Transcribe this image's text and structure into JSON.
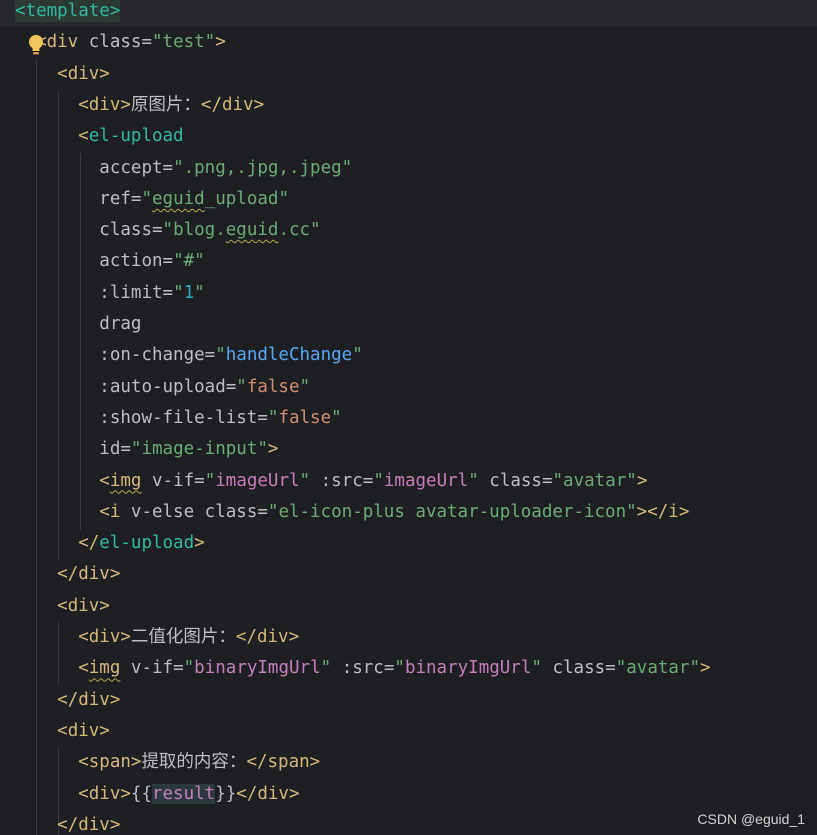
{
  "editor": {
    "language": "vue",
    "background": "#1e1f22",
    "current_line_background": "#26282e",
    "colors": {
      "tag": "#d5b778",
      "attribute": "#bcbec4",
      "string": "#6aab73",
      "number": "#2aacb8",
      "handler": "#56a8f5",
      "expression": "#c77dbb",
      "template_tag": "#2fb9a0",
      "boolean": "#cf8e6d"
    },
    "intention_icon": "lightbulb-icon",
    "lines": [
      {
        "segments": [
          {
            "text": "<template>",
            "cls": "c-template-tag"
          }
        ],
        "current": true
      },
      {
        "segments": [
          {
            "text": "  ",
            "cls": "c-plain"
          },
          {
            "text": "<div ",
            "cls": "c-tag"
          },
          {
            "text": "class",
            "cls": "c-attr"
          },
          {
            "text": "=",
            "cls": "c-plain"
          },
          {
            "text": "\"test\"",
            "cls": "c-str"
          },
          {
            "text": ">",
            "cls": "c-tag"
          }
        ]
      },
      {
        "segments": [
          {
            "text": "    ",
            "cls": "c-plain"
          },
          {
            "text": "<div>",
            "cls": "c-tag"
          }
        ]
      },
      {
        "segments": [
          {
            "text": "      ",
            "cls": "c-plain"
          },
          {
            "text": "<div>",
            "cls": "c-tag"
          },
          {
            "text": "原图片：",
            "cls": "c-cjk"
          },
          {
            "text": "</div>",
            "cls": "c-tag"
          }
        ]
      },
      {
        "segments": [
          {
            "text": "      ",
            "cls": "c-plain"
          },
          {
            "text": "<",
            "cls": "c-tag"
          },
          {
            "text": "el-upload",
            "cls": "c-teal"
          }
        ]
      },
      {
        "segments": [
          {
            "text": "        ",
            "cls": "c-plain"
          },
          {
            "text": "accept",
            "cls": "c-attr"
          },
          {
            "text": "=",
            "cls": "c-plain"
          },
          {
            "text": "\".png,.jpg,.jpeg\"",
            "cls": "c-str"
          }
        ]
      },
      {
        "segments": [
          {
            "text": "        ",
            "cls": "c-plain"
          },
          {
            "text": "ref",
            "cls": "c-attr"
          },
          {
            "text": "=",
            "cls": "c-plain"
          },
          {
            "text": "\"",
            "cls": "c-str"
          },
          {
            "text": "eguid",
            "cls": "c-str squiggle"
          },
          {
            "text": "_upload\"",
            "cls": "c-str"
          }
        ]
      },
      {
        "segments": [
          {
            "text": "        ",
            "cls": "c-plain"
          },
          {
            "text": "class",
            "cls": "c-attr"
          },
          {
            "text": "=",
            "cls": "c-plain"
          },
          {
            "text": "\"blog.",
            "cls": "c-str"
          },
          {
            "text": "eguid",
            "cls": "c-str squiggle"
          },
          {
            "text": ".cc\"",
            "cls": "c-str"
          }
        ]
      },
      {
        "segments": [
          {
            "text": "        ",
            "cls": "c-plain"
          },
          {
            "text": "action",
            "cls": "c-attr"
          },
          {
            "text": "=",
            "cls": "c-plain"
          },
          {
            "text": "\"#\"",
            "cls": "c-str"
          }
        ]
      },
      {
        "segments": [
          {
            "text": "        ",
            "cls": "c-plain"
          },
          {
            "text": ":limit",
            "cls": "c-attr"
          },
          {
            "text": "=",
            "cls": "c-plain"
          },
          {
            "text": "\"",
            "cls": "c-str"
          },
          {
            "text": "1",
            "cls": "c-num"
          },
          {
            "text": "\"",
            "cls": "c-str"
          }
        ]
      },
      {
        "segments": [
          {
            "text": "        ",
            "cls": "c-plain"
          },
          {
            "text": "drag",
            "cls": "c-attr"
          }
        ]
      },
      {
        "segments": [
          {
            "text": "        ",
            "cls": "c-plain"
          },
          {
            "text": ":on-change",
            "cls": "c-attr"
          },
          {
            "text": "=",
            "cls": "c-plain"
          },
          {
            "text": "\"",
            "cls": "c-str"
          },
          {
            "text": "handleChange",
            "cls": "c-ref"
          },
          {
            "text": "\"",
            "cls": "c-str"
          }
        ]
      },
      {
        "segments": [
          {
            "text": "        ",
            "cls": "c-plain"
          },
          {
            "text": ":auto-upload",
            "cls": "c-attr"
          },
          {
            "text": "=",
            "cls": "c-plain"
          },
          {
            "text": "\"",
            "cls": "c-str"
          },
          {
            "text": "false",
            "cls": "c-bool"
          },
          {
            "text": "\"",
            "cls": "c-str"
          }
        ]
      },
      {
        "segments": [
          {
            "text": "        ",
            "cls": "c-plain"
          },
          {
            "text": ":show-file-list",
            "cls": "c-attr"
          },
          {
            "text": "=",
            "cls": "c-plain"
          },
          {
            "text": "\"",
            "cls": "c-str"
          },
          {
            "text": "false",
            "cls": "c-bool"
          },
          {
            "text": "\"",
            "cls": "c-str"
          }
        ]
      },
      {
        "segments": [
          {
            "text": "        ",
            "cls": "c-plain"
          },
          {
            "text": "id",
            "cls": "c-attr"
          },
          {
            "text": "=",
            "cls": "c-plain"
          },
          {
            "text": "\"image-input\"",
            "cls": "c-str"
          },
          {
            "text": ">",
            "cls": "c-tag"
          }
        ]
      },
      {
        "segments": [
          {
            "text": "        ",
            "cls": "c-plain"
          },
          {
            "text": "<",
            "cls": "c-tag"
          },
          {
            "text": "img",
            "cls": "c-tag squiggle"
          },
          {
            "text": " ",
            "cls": "c-plain"
          },
          {
            "text": "v-if",
            "cls": "c-attr"
          },
          {
            "text": "=",
            "cls": "c-plain"
          },
          {
            "text": "\"",
            "cls": "c-str"
          },
          {
            "text": "imageUrl",
            "cls": "c-expr"
          },
          {
            "text": "\"",
            "cls": "c-str"
          },
          {
            "text": " ",
            "cls": "c-plain"
          },
          {
            "text": ":src",
            "cls": "c-attr"
          },
          {
            "text": "=",
            "cls": "c-plain"
          },
          {
            "text": "\"",
            "cls": "c-str"
          },
          {
            "text": "imageUrl",
            "cls": "c-expr"
          },
          {
            "text": "\"",
            "cls": "c-str"
          },
          {
            "text": " ",
            "cls": "c-plain"
          },
          {
            "text": "class",
            "cls": "c-attr"
          },
          {
            "text": "=",
            "cls": "c-plain"
          },
          {
            "text": "\"avatar\"",
            "cls": "c-str"
          },
          {
            "text": ">",
            "cls": "c-tag"
          }
        ]
      },
      {
        "segments": [
          {
            "text": "        ",
            "cls": "c-plain"
          },
          {
            "text": "<i ",
            "cls": "c-tag"
          },
          {
            "text": "v-else",
            "cls": "c-attr"
          },
          {
            "text": " ",
            "cls": "c-plain"
          },
          {
            "text": "class",
            "cls": "c-attr"
          },
          {
            "text": "=",
            "cls": "c-plain"
          },
          {
            "text": "\"el-icon-plus avatar-uploader-icon\"",
            "cls": "c-str"
          },
          {
            "text": "></i>",
            "cls": "c-tag"
          }
        ]
      },
      {
        "segments": [
          {
            "text": "      ",
            "cls": "c-plain"
          },
          {
            "text": "</",
            "cls": "c-tag"
          },
          {
            "text": "el-upload",
            "cls": "c-teal"
          },
          {
            "text": ">",
            "cls": "c-tag"
          }
        ]
      },
      {
        "segments": [
          {
            "text": "    ",
            "cls": "c-plain"
          },
          {
            "text": "</div>",
            "cls": "c-tag"
          }
        ]
      },
      {
        "segments": [
          {
            "text": "    ",
            "cls": "c-plain"
          },
          {
            "text": "<div>",
            "cls": "c-tag"
          }
        ]
      },
      {
        "segments": [
          {
            "text": "      ",
            "cls": "c-plain"
          },
          {
            "text": "<div>",
            "cls": "c-tag"
          },
          {
            "text": "二值化图片：",
            "cls": "c-cjk"
          },
          {
            "text": "</div>",
            "cls": "c-tag"
          }
        ]
      },
      {
        "segments": [
          {
            "text": "      ",
            "cls": "c-plain"
          },
          {
            "text": "<",
            "cls": "c-tag"
          },
          {
            "text": "img",
            "cls": "c-tag squiggle"
          },
          {
            "text": " ",
            "cls": "c-plain"
          },
          {
            "text": "v-if",
            "cls": "c-attr"
          },
          {
            "text": "=",
            "cls": "c-plain"
          },
          {
            "text": "\"",
            "cls": "c-str"
          },
          {
            "text": "binaryImgUrl",
            "cls": "c-expr"
          },
          {
            "text": "\"",
            "cls": "c-str"
          },
          {
            "text": " ",
            "cls": "c-plain"
          },
          {
            "text": ":src",
            "cls": "c-attr"
          },
          {
            "text": "=",
            "cls": "c-plain"
          },
          {
            "text": "\"",
            "cls": "c-str"
          },
          {
            "text": "binaryImgUrl",
            "cls": "c-expr"
          },
          {
            "text": "\"",
            "cls": "c-str"
          },
          {
            "text": " ",
            "cls": "c-plain"
          },
          {
            "text": "class",
            "cls": "c-attr"
          },
          {
            "text": "=",
            "cls": "c-plain"
          },
          {
            "text": "\"avatar\"",
            "cls": "c-str"
          },
          {
            "text": ">",
            "cls": "c-tag"
          }
        ]
      },
      {
        "segments": [
          {
            "text": "    ",
            "cls": "c-plain"
          },
          {
            "text": "</div>",
            "cls": "c-tag"
          }
        ]
      },
      {
        "segments": [
          {
            "text": "    ",
            "cls": "c-plain"
          },
          {
            "text": "<div>",
            "cls": "c-tag"
          }
        ]
      },
      {
        "segments": [
          {
            "text": "      ",
            "cls": "c-plain"
          },
          {
            "text": "<span>",
            "cls": "c-tag"
          },
          {
            "text": "提取的内容：",
            "cls": "c-cjk"
          },
          {
            "text": "</span>",
            "cls": "c-tag"
          }
        ]
      },
      {
        "segments": [
          {
            "text": "      ",
            "cls": "c-plain"
          },
          {
            "text": "<div>",
            "cls": "c-tag"
          },
          {
            "text": "{{",
            "cls": "c-plain"
          },
          {
            "text": "result",
            "cls": "c-ident-hl"
          },
          {
            "text": "}}",
            "cls": "c-plain"
          },
          {
            "text": "</div>",
            "cls": "c-tag"
          }
        ]
      },
      {
        "segments": [
          {
            "text": "    ",
            "cls": "c-plain"
          },
          {
            "text": "</div>",
            "cls": "c-tag"
          }
        ]
      }
    ]
  },
  "watermark": {
    "text": "CSDN @eguid_1"
  }
}
